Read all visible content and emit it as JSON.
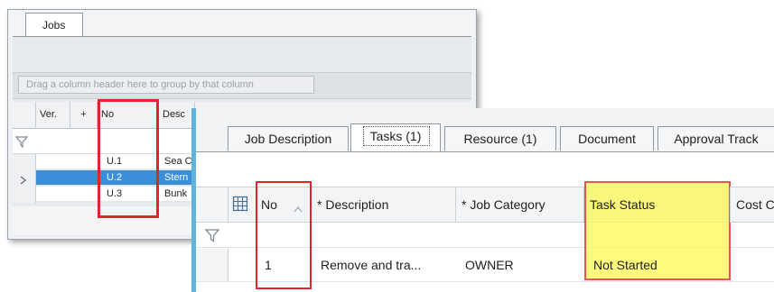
{
  "back_window": {
    "tab_label": "Jobs",
    "group_hint": "Drag a column header here to group by that column",
    "columns": [
      "Ver.",
      "+",
      "No",
      "Desc"
    ],
    "rows": [
      {
        "no": "U.1",
        "desc": "Sea C",
        "selected": false
      },
      {
        "no": "U.2",
        "desc": "Stern",
        "selected": true
      },
      {
        "no": "U.3",
        "desc": "Bunk",
        "selected": false
      }
    ]
  },
  "front_window": {
    "tabs": [
      "Job Description",
      "Tasks (1)",
      "Resource (1)",
      "Document",
      "Approval Track"
    ],
    "active_tab": "Tasks (1)",
    "columns": [
      "No",
      "* Description",
      "* Job Category",
      "Task Status",
      "Cost C"
    ],
    "row": {
      "no": "1",
      "description": "Remove and tra...",
      "job_category": "OWNER",
      "task_status": "Not Started"
    }
  },
  "colors": {
    "highlight_red": "#e0242b",
    "highlight_yellow": "#fff95a",
    "selection_blue": "#3d8ed8",
    "accent_cyan": "#5fb5d9"
  }
}
